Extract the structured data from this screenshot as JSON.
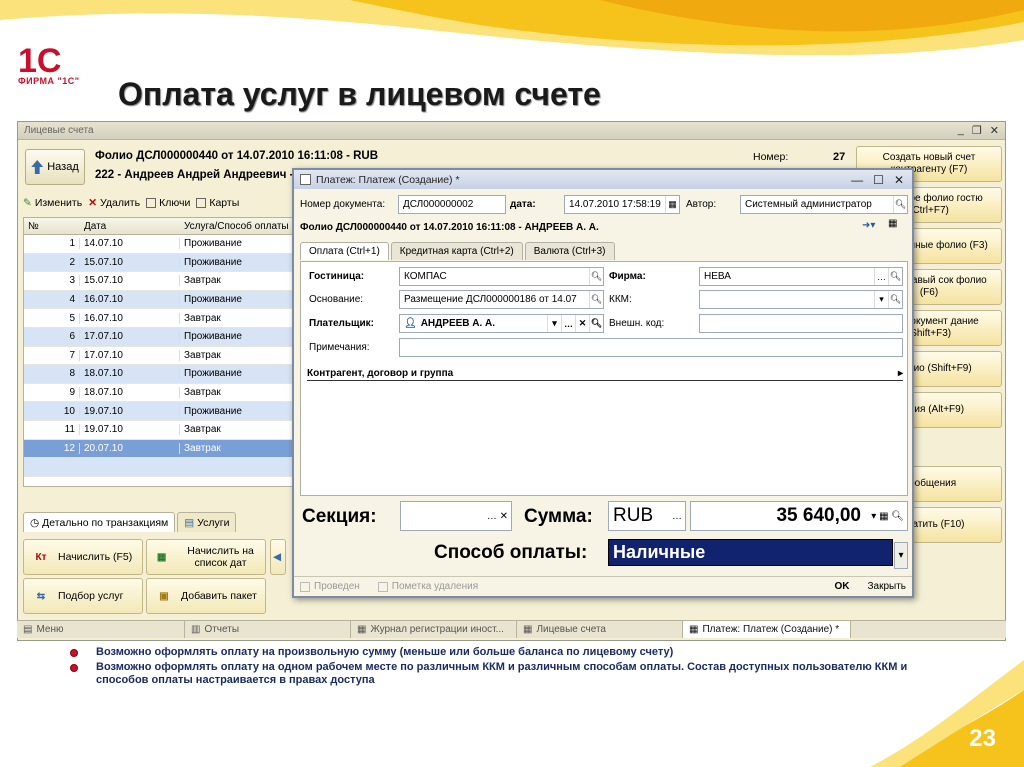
{
  "slide": {
    "title": "Оплата услуг в лицевом счете",
    "logo_text": "ФИРМА \"1С\"",
    "logo_mark": "1С",
    "page_number": "23",
    "bullets": [
      "Возможно оформлять оплату на произвольную сумму (меньше или больше баланса по лицевому счету)",
      "Возможно оформлять оплату на одном рабочем месте по различным ККМ и различным способам оплаты. Состав доступных пользователю ККМ и способов оплаты настраивается в правах доступа"
    ]
  },
  "main_window": {
    "title": "Лицевые счета",
    "back_label": "Назад",
    "folio_line1": "Фолио ДСЛ000000440 от 14.07.2010 16:11:08 - RUB",
    "folio_line2": "222 - Андреев Андрей Андреевич -",
    "number_label": "Номер:",
    "number_value": "27",
    "toolbar": {
      "edit": "Изменить",
      "delete": "Удалить",
      "keys": "Ключи",
      "cards": "Карты"
    },
    "grid": {
      "headers": [
        "№",
        "Дата",
        "Услуга/Способ оплаты"
      ],
      "rows": [
        {
          "n": "1",
          "date": "14.07.10",
          "svc": "Проживание"
        },
        {
          "n": "2",
          "date": "15.07.10",
          "svc": "Проживание"
        },
        {
          "n": "3",
          "date": "15.07.10",
          "svc": "Завтрак"
        },
        {
          "n": "4",
          "date": "16.07.10",
          "svc": "Проживание"
        },
        {
          "n": "5",
          "date": "16.07.10",
          "svc": "Завтрак"
        },
        {
          "n": "6",
          "date": "17.07.10",
          "svc": "Проживание"
        },
        {
          "n": "7",
          "date": "17.07.10",
          "svc": "Завтрак"
        },
        {
          "n": "8",
          "date": "18.07.10",
          "svc": "Проживание"
        },
        {
          "n": "9",
          "date": "18.07.10",
          "svc": "Завтрак"
        },
        {
          "n": "10",
          "date": "19.07.10",
          "svc": "Проживание"
        },
        {
          "n": "11",
          "date": "19.07.10",
          "svc": "Завтрак"
        },
        {
          "n": "12",
          "date": "20.07.10",
          "svc": "Завтрак"
        }
      ]
    },
    "bottom_tabs": [
      "Детально по транзакциям",
      "Услуги"
    ],
    "buttons": {
      "charge": "Начислить (F5)",
      "charge_dates": "Начислить на список дат",
      "pick_services": "Подбор услуг",
      "add_package": "Добавить пакет",
      "pay": "Оплатить (F10)"
    },
    "right_buttons": [
      "Создать новый счет контрагенту (F7)",
      "ать новое фолио гостю (Ctrl+F7)",
      "азать данные фолио (F3)",
      "крыть правый сок фолио (F6)",
      "рыть документ дание (Shift+F3)",
      "э фолио (Shift+F9)",
      "йствия (Alt+F9)",
      "Сообщения"
    ],
    "taskbar": [
      "Меню",
      "Отчеты",
      "Журнал регистрации иност...",
      "Лицевые счета",
      "Платеж: Платеж (Создание) *"
    ]
  },
  "dialog": {
    "title": "Платеж: Платеж (Создание) *",
    "doc_number_label": "Номер документа:",
    "doc_number_value": "ДСЛ000000002",
    "date_label": "дата:",
    "date_value": "14.07.2010 17:58:19",
    "author_label": "Автор:",
    "author_value": "Системный администратор",
    "folio_info": "Фолио ДСЛ000000440 от 14.07.2010 16:11:08 - АНДРЕЕВ А. А.",
    "tabs": [
      "Оплата (Ctrl+1)",
      "Кредитная карта (Ctrl+2)",
      "Валюта (Ctrl+3)"
    ],
    "hotel_label": "Гостиница:",
    "hotel_value": "КОМПАС",
    "firm_label": "Фирма:",
    "firm_value": "НЕВА",
    "basis_label": "Основание:",
    "basis_value": "Размещение ДСЛ000000186 от 14.07",
    "kkm_label": "ККМ:",
    "kkm_value": "",
    "payer_label": "Плательщик:",
    "payer_value": "АНДРЕЕВ А. А.",
    "ext_code_label": "Внешн. код:",
    "ext_code_value": "",
    "notes_label": "Примечания:",
    "notes_value": "",
    "group_label": "Контрагент, договор и группа",
    "section_label": "Секция:",
    "section_value": "",
    "sum_label": "Сумма:",
    "currency_value": "RUB",
    "sum_value": "35 640,00",
    "pay_method_label": "Способ оплаты:",
    "pay_method_value": "Наличные",
    "posted_label": "Проведен",
    "deletion_label": "Пометка удаления",
    "ok_label": "OK",
    "close_label": "Закрыть"
  },
  "colors": {
    "accent_red": "#c8102e",
    "selection_blue": "#11236e",
    "swoosh": "#f7c21d"
  }
}
